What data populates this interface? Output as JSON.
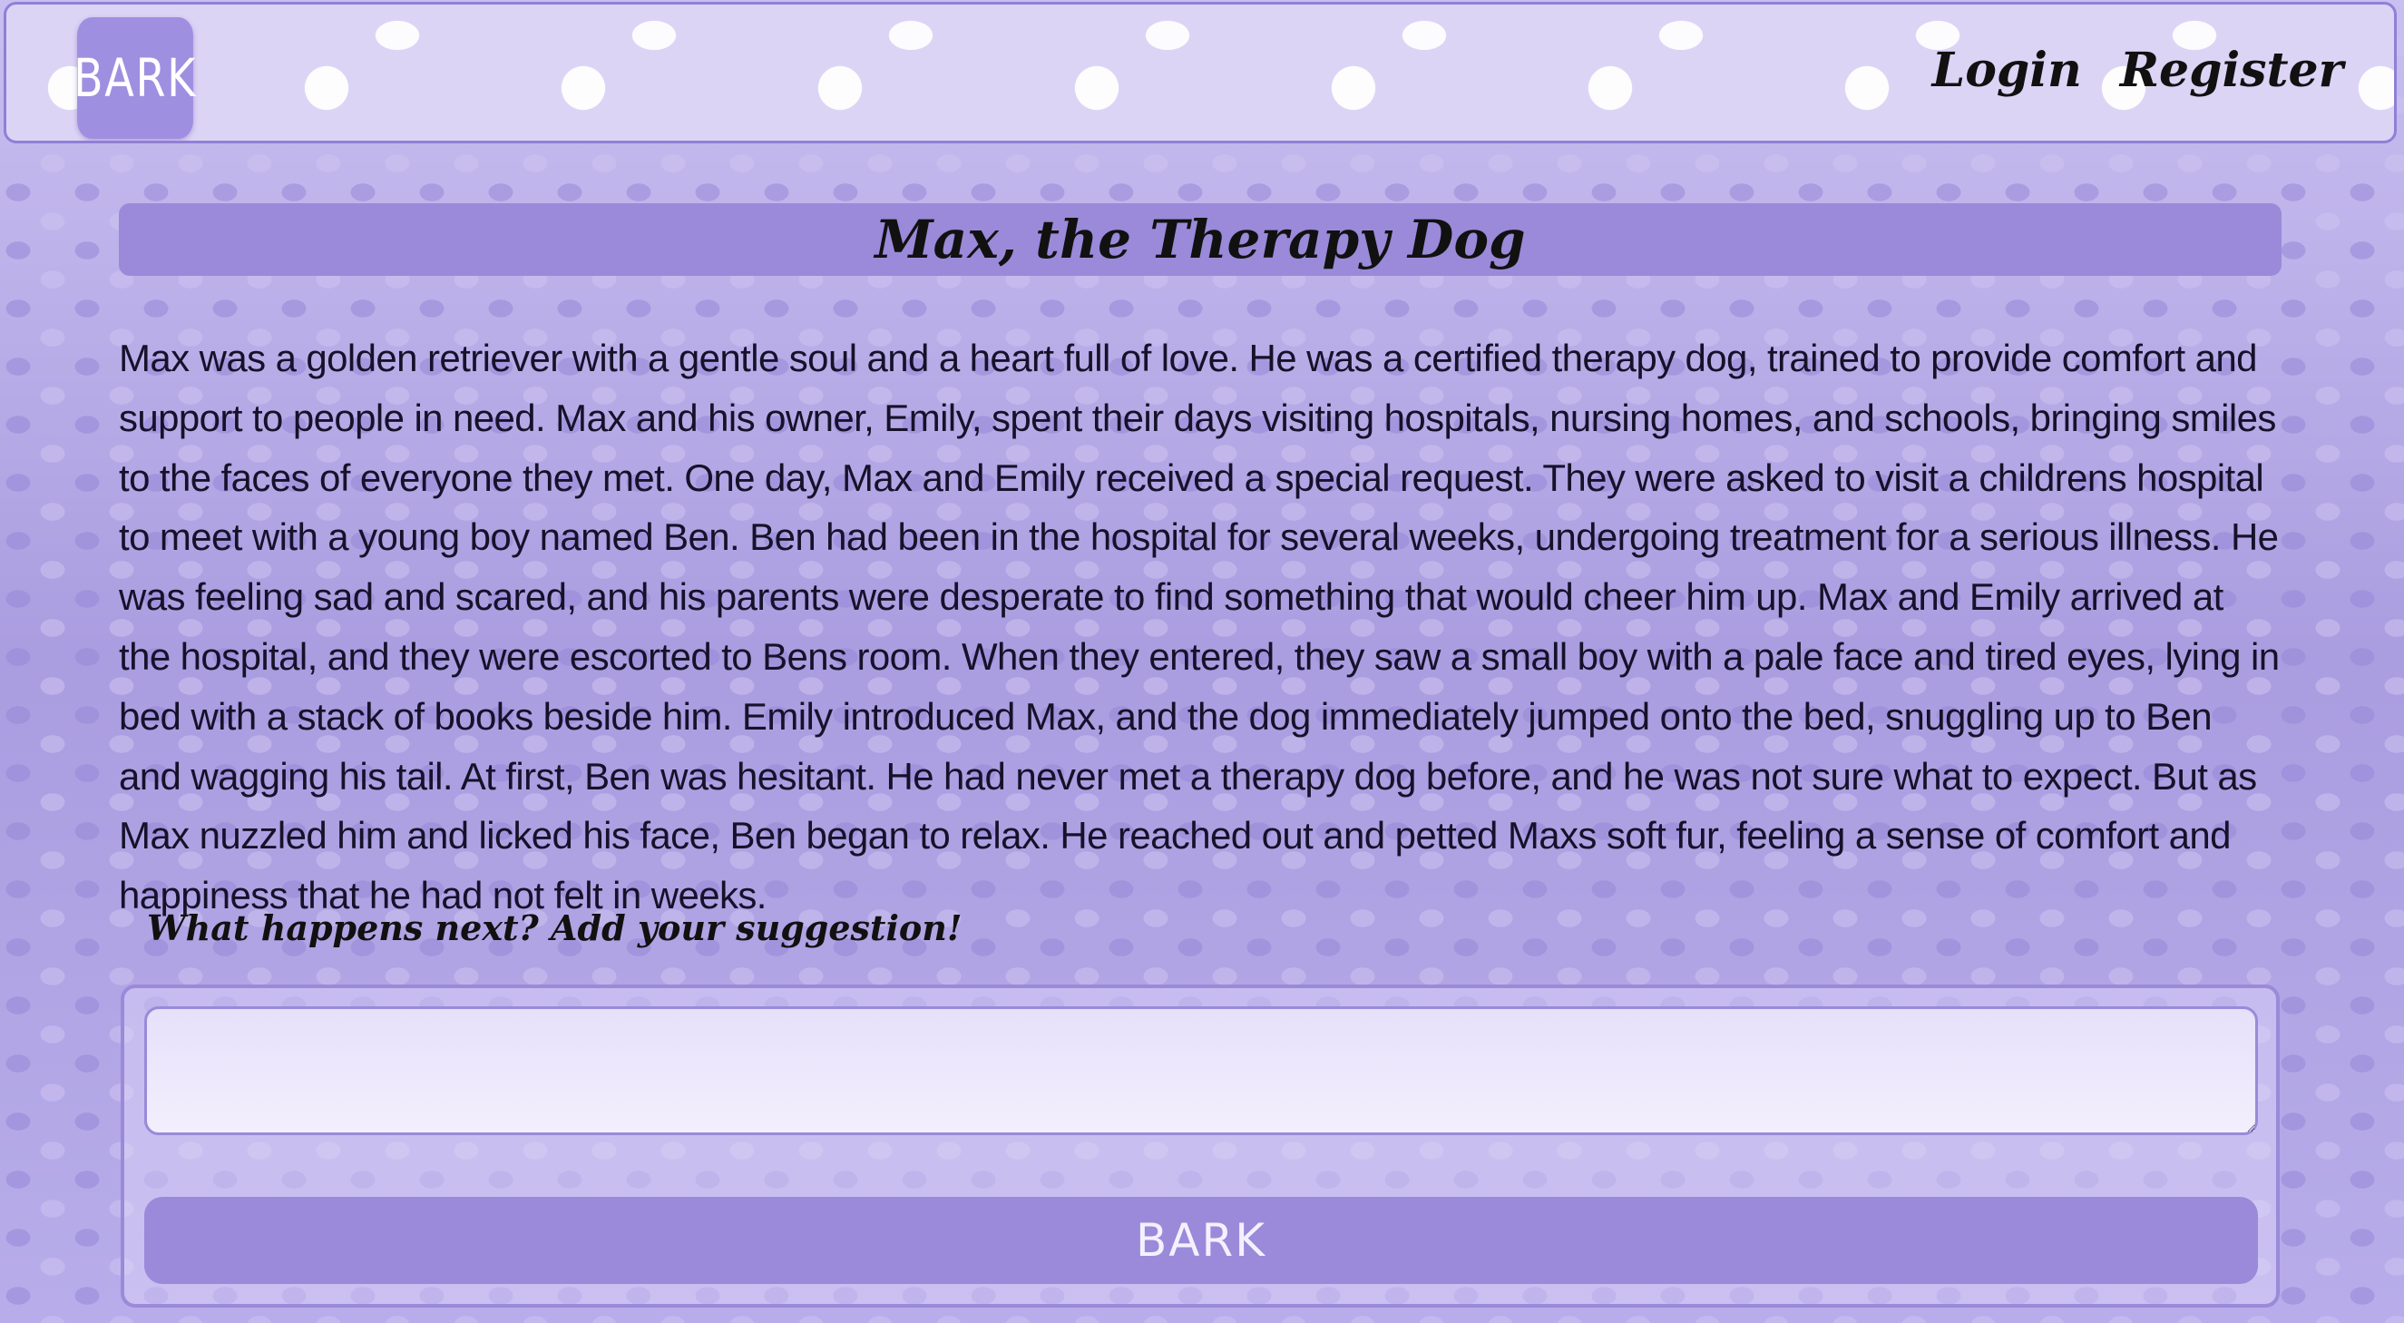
{
  "header": {
    "logo_text": "BARK",
    "nav": {
      "login": "Login",
      "register": "Register"
    }
  },
  "story": {
    "title": "Max, the Therapy Dog",
    "body": "Max was a golden retriever with a gentle soul and a heart full of love. He was a certified therapy dog, trained to provide comfort and support to people in need. Max and his owner, Emily, spent their days visiting hospitals, nursing homes, and schools, bringing smiles to the faces of everyone they met. One day, Max and Emily received a special request. They were asked to visit a childrens hospital to meet with a young boy named Ben. Ben had been in the hospital for several weeks, undergoing treatment for a serious illness. He was feeling sad and scared, and his parents were desperate to find something that would cheer him up. Max and Emily arrived at the hospital, and they were escorted to Bens room. When they entered, they saw a small boy with a pale face and tired eyes, lying in bed with a stack of books beside him. Emily introduced Max, and the dog immediately jumped onto the bed, snuggling up to Ben and wagging his tail. At first, Ben was hesitant. He had never met a therapy dog before, and he was not sure what to expect. But as Max nuzzled him and licked his face, Ben began to relax. He reached out and petted Maxs soft fur, feeling a sense of comfort and happiness that he had not felt in weeks."
  },
  "suggestion": {
    "prompt": "What happens next? Add your suggestion!",
    "input_value": "",
    "submit_label": "BARK"
  },
  "colors": {
    "accent": "#9a8ad9",
    "background": "#b5a9e6",
    "header_bg": "#dcd4f5",
    "text": "#111111"
  }
}
